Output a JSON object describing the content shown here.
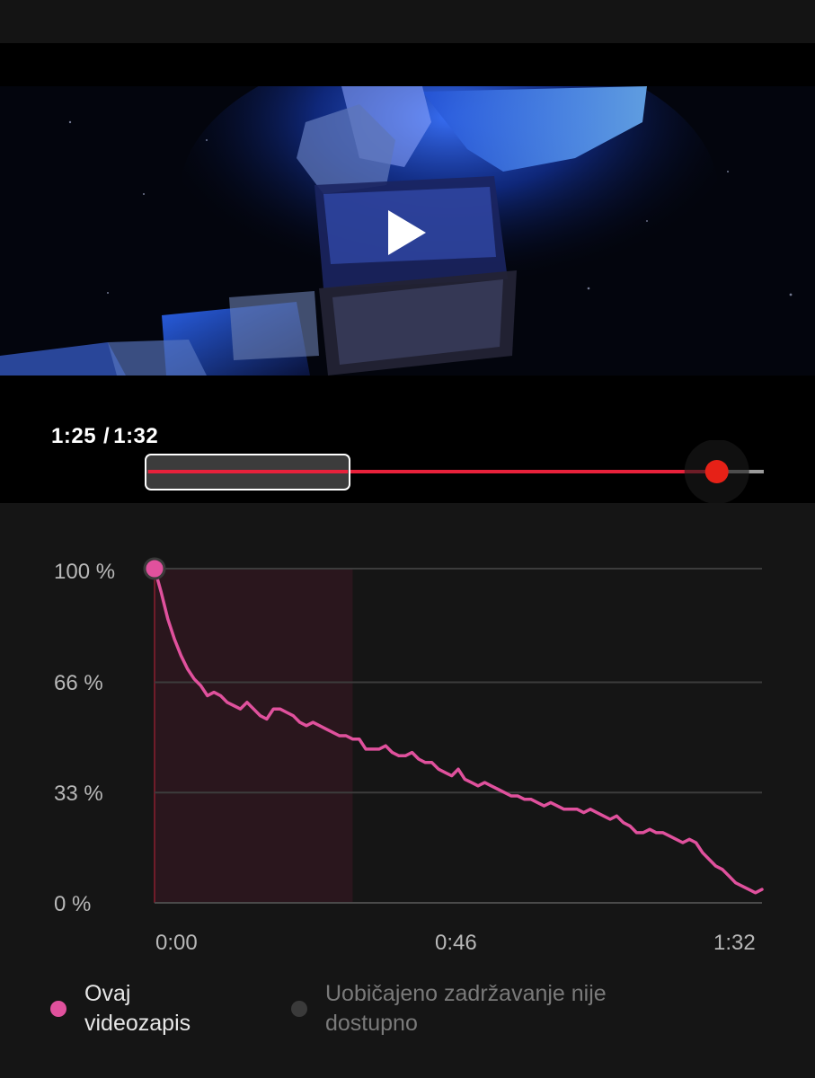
{
  "player": {
    "current_time": "1:25",
    "separator": "/",
    "duration": "1:32",
    "progress_fraction": 0.924,
    "selection_start_fraction": 0.0,
    "selection_end_fraction": 0.33,
    "play_icon": "play-icon",
    "colors": {
      "progress": "#e8213b",
      "playhead": "#e62117",
      "remaining": "#9a9a9a"
    }
  },
  "chart_data": {
    "type": "line",
    "title": "",
    "xlabel": "",
    "ylabel": "",
    "ylim": [
      0,
      100
    ],
    "xlim": [
      0,
      92
    ],
    "yticks": [
      "100 %",
      "66 %",
      "33 %",
      "0 %"
    ],
    "ytick_values": [
      100,
      66,
      33,
      0
    ],
    "xticks": [
      "0:00",
      "0:46",
      "1:32"
    ],
    "xtick_values": [
      0,
      46,
      92
    ],
    "grid": true,
    "highlight_range": [
      0,
      30
    ],
    "series": [
      {
        "name": "Ovaj videozapis",
        "color": "#e0519d",
        "x": [
          0,
          1,
          2,
          3,
          4,
          5,
          6,
          7,
          8,
          9,
          10,
          11,
          12,
          13,
          14,
          15,
          16,
          17,
          18,
          19,
          20,
          21,
          22,
          23,
          24,
          25,
          26,
          27,
          28,
          29,
          30,
          31,
          32,
          33,
          34,
          35,
          36,
          37,
          38,
          39,
          40,
          41,
          42,
          43,
          44,
          45,
          46,
          47,
          48,
          49,
          50,
          51,
          52,
          53,
          54,
          55,
          56,
          57,
          58,
          59,
          60,
          61,
          62,
          63,
          64,
          65,
          66,
          67,
          68,
          69,
          70,
          71,
          72,
          73,
          74,
          75,
          76,
          77,
          78,
          79,
          80,
          81,
          82,
          83,
          84,
          85,
          86,
          87,
          88,
          89,
          90,
          91,
          92
        ],
        "values": [
          100,
          93,
          85,
          79,
          74,
          70,
          67,
          65,
          62,
          63,
          62,
          60,
          59,
          58,
          60,
          58,
          56,
          55,
          58,
          58,
          57,
          56,
          54,
          53,
          54,
          53,
          52,
          51,
          50,
          50,
          49,
          49,
          46,
          46,
          46,
          47,
          45,
          44,
          44,
          45,
          43,
          42,
          42,
          40,
          39,
          38,
          40,
          37,
          36,
          35,
          36,
          35,
          34,
          33,
          32,
          32,
          31,
          31,
          30,
          29,
          30,
          29,
          28,
          28,
          28,
          27,
          28,
          27,
          26,
          25,
          26,
          24,
          23,
          21,
          21,
          22,
          21,
          21,
          20,
          19,
          18,
          19,
          18,
          15,
          13,
          11,
          10,
          8,
          6,
          5,
          4,
          3,
          4
        ]
      }
    ]
  },
  "legend": {
    "this_video": {
      "label_line1": "Ovaj",
      "label_line2": "videozapis",
      "color": "#e0519d"
    },
    "typical": {
      "label_line1": "Uobičajeno zadržavanje nije",
      "label_line2": "dostupno",
      "color": "#3a3a3a"
    }
  }
}
